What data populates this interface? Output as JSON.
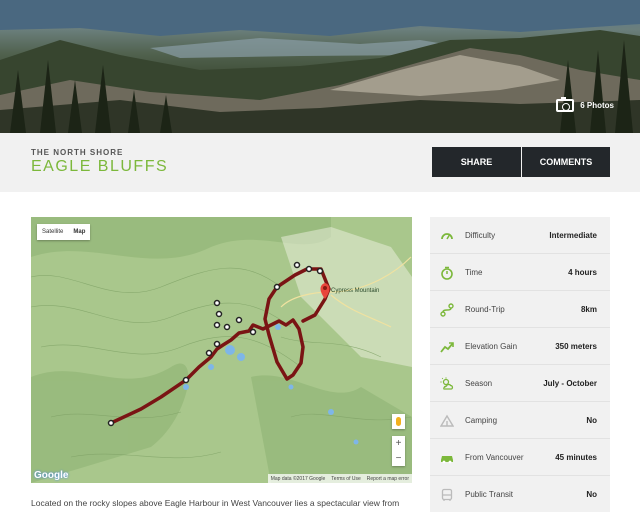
{
  "hero": {
    "photos_label": "6 Photos",
    "camera_icon": "camera-icon"
  },
  "header": {
    "region": "THE NORTH SHORE",
    "trail_name": "EAGLE BLUFFS",
    "share_label": "SHARE",
    "comments_label": "COMMENTS"
  },
  "map": {
    "type_satellite": "Satellite",
    "type_map": "Map",
    "mountain_label": "Cypress Mountain",
    "zoom_in": "+",
    "zoom_out": "−",
    "google_logo": "Google",
    "attribution": "Map data ©2017 Google",
    "terms": "Terms of Use",
    "report": "Report a map error"
  },
  "stats": [
    {
      "label": "Difficulty",
      "value": "Intermediate",
      "icon": "gauge-icon"
    },
    {
      "label": "Time",
      "value": "4 hours",
      "icon": "stopwatch-icon"
    },
    {
      "label": "Round-Trip",
      "value": "8km",
      "icon": "route-icon"
    },
    {
      "label": "Elevation Gain",
      "value": "350 meters",
      "icon": "trend-up-icon"
    },
    {
      "label": "Season",
      "value": "July - October",
      "icon": "sun-cloud-icon"
    },
    {
      "label": "Camping",
      "value": "No",
      "icon": "tent-icon"
    },
    {
      "label": "From Vancouver",
      "value": "45 minutes",
      "icon": "car-icon"
    },
    {
      "label": "Public Transit",
      "value": "No",
      "icon": "bus-icon"
    }
  ],
  "colors": {
    "accent": "#7cb83b",
    "button_bg": "#23272b",
    "trail_line": "#7a1414"
  },
  "description": "Located on the rocky slopes above Eagle Harbour in West Vancouver lies a spectacular view from"
}
